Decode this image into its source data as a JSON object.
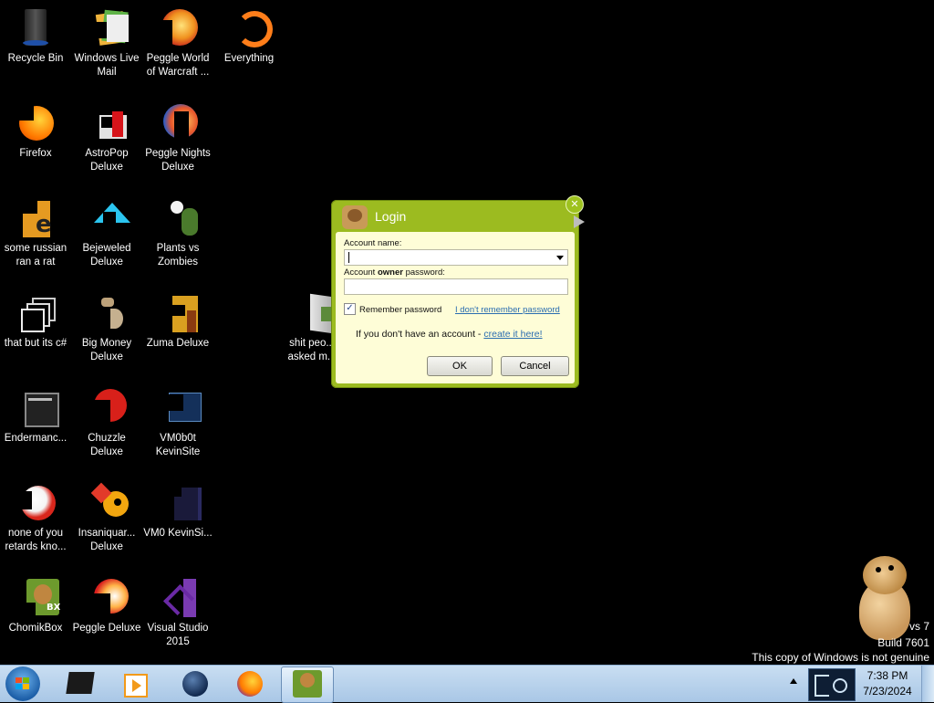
{
  "desktop": {
    "icons": [
      {
        "label": "Recycle Bin"
      },
      {
        "label": "Windows Live Mail"
      },
      {
        "label": "Peggle World of Warcraft ..."
      },
      {
        "label": "Everything"
      },
      {
        "label": "Firefox"
      },
      {
        "label": "AstroPop Deluxe"
      },
      {
        "label": "Peggle Nights Deluxe"
      },
      {
        "label": "some russian ran a rat"
      },
      {
        "label": "Bejeweled Deluxe"
      },
      {
        "label": "Plants vs Zombies"
      },
      {
        "label": "that but its c#"
      },
      {
        "label": "Big Money Deluxe"
      },
      {
        "label": "Zuma Deluxe"
      },
      {
        "label": "shit peo... asked m..."
      },
      {
        "label": "Endermanc..."
      },
      {
        "label": "Chuzzle Deluxe"
      },
      {
        "label": "VM0b0t KevinSite"
      },
      {
        "label": "none of you retards kno..."
      },
      {
        "label": "Insaniquar... Deluxe"
      },
      {
        "label": "VM0 KevinSi..."
      },
      {
        "label": "ChomikBox"
      },
      {
        "label": "Peggle Deluxe"
      },
      {
        "label": "Visual Studio 2015"
      }
    ]
  },
  "dialog": {
    "title": "Login",
    "account_name_label": "Account name:",
    "password_label_pre": "Account ",
    "password_label_bold": "owner",
    "password_label_post": " password:",
    "remember_label": "Remember password",
    "remember_checked": true,
    "forgot_link": "I don't remember password",
    "no_account_text": "If you don't have an account - ",
    "create_link": "create it here!",
    "ok_label": "OK",
    "cancel_label": "Cancel"
  },
  "watermark": {
    "line1": "vs 7",
    "line2": "Build 7601",
    "line3": "This copy of Windows is not genuine"
  },
  "taskbar": {
    "time": "7:38 PM",
    "date": "7/23/2024"
  },
  "colors": {
    "dialog_frame": "#9cbb20",
    "dialog_body": "#fefdd7",
    "link": "#2a6db0",
    "taskbar": "#b9d3ee"
  }
}
